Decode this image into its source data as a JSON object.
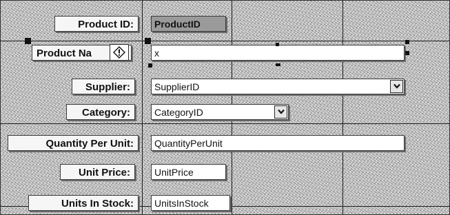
{
  "form": {
    "fields": [
      {
        "label": "Product ID:",
        "value": "ProductID"
      },
      {
        "label": "Product Na",
        "value": "x"
      },
      {
        "label": "Supplier:",
        "value": "SupplierID"
      },
      {
        "label": "Category:",
        "value": "CategoryID"
      },
      {
        "label": "Quantity Per Unit:",
        "value": "QuantityPerUnit"
      },
      {
        "label": "Unit Price:",
        "value": "UnitPrice"
      },
      {
        "label": "Units In Stock:",
        "value": "UnitsInStock"
      }
    ]
  },
  "icons": {
    "warning": "error-warning-icon",
    "dropdown": "chevron-down-icon"
  },
  "colors": {
    "canvas": "#b8b8b8",
    "gridline": "#1a1a1a",
    "bound_field": "#9a9a9a"
  }
}
